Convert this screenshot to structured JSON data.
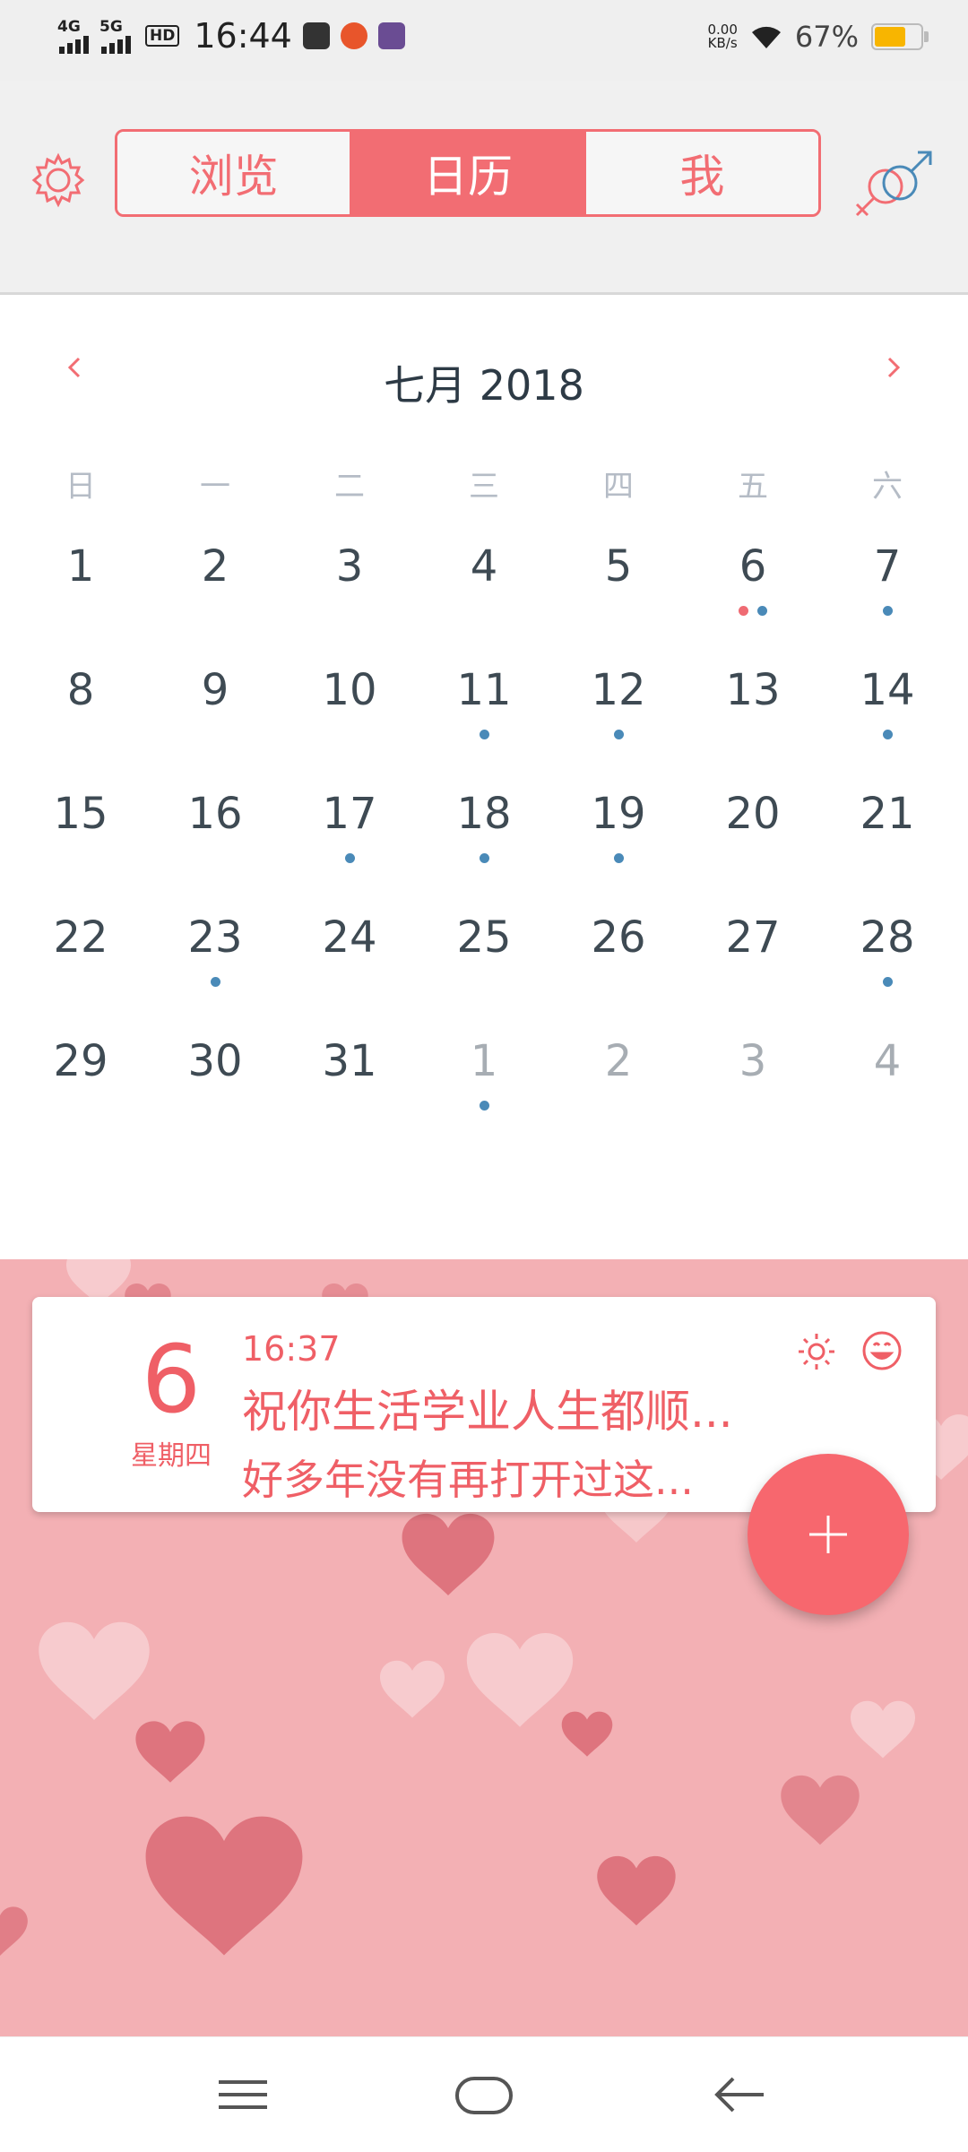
{
  "status_bar": {
    "network1": "4G",
    "network2": "5G",
    "hd_label": "HD",
    "time": "16:44",
    "speed_value": "0.00",
    "speed_unit": "KB/s",
    "battery_percent": "67%",
    "battery_level": 0.67,
    "battery_color": "#f8b500"
  },
  "header": {
    "tabs": [
      {
        "label": "浏览",
        "active": false
      },
      {
        "label": "日历",
        "active": true
      },
      {
        "label": "我",
        "active": false
      }
    ],
    "accent_color": "#f26d73",
    "settings_icon": "gear-icon",
    "gender_icon": "gender-symbols-icon"
  },
  "calendar": {
    "month_title": "七月 2018",
    "weekdays": [
      "日",
      "一",
      "二",
      "三",
      "四",
      "五",
      "六"
    ],
    "days": [
      {
        "day": "1",
        "dots": []
      },
      {
        "day": "2",
        "dots": []
      },
      {
        "day": "3",
        "dots": []
      },
      {
        "day": "4",
        "dots": []
      },
      {
        "day": "5",
        "dots": []
      },
      {
        "day": "6",
        "dots": [
          "red",
          "blue"
        ]
      },
      {
        "day": "7",
        "dots": [
          "blue"
        ]
      },
      {
        "day": "8",
        "dots": []
      },
      {
        "day": "9",
        "dots": []
      },
      {
        "day": "10",
        "dots": []
      },
      {
        "day": "11",
        "dots": [
          "blue"
        ]
      },
      {
        "day": "12",
        "dots": [
          "blue"
        ]
      },
      {
        "day": "13",
        "dots": []
      },
      {
        "day": "14",
        "dots": [
          "blue"
        ]
      },
      {
        "day": "15",
        "dots": []
      },
      {
        "day": "16",
        "dots": []
      },
      {
        "day": "17",
        "dots": [
          "blue"
        ]
      },
      {
        "day": "18",
        "dots": [
          "blue"
        ]
      },
      {
        "day": "19",
        "dots": [
          "blue"
        ]
      },
      {
        "day": "20",
        "dots": []
      },
      {
        "day": "21",
        "dots": []
      },
      {
        "day": "22",
        "dots": []
      },
      {
        "day": "23",
        "dots": [
          "blue"
        ]
      },
      {
        "day": "24",
        "dots": []
      },
      {
        "day": "25",
        "dots": []
      },
      {
        "day": "26",
        "dots": []
      },
      {
        "day": "27",
        "dots": []
      },
      {
        "day": "28",
        "dots": [
          "blue"
        ]
      },
      {
        "day": "29",
        "dots": []
      },
      {
        "day": "30",
        "dots": []
      },
      {
        "day": "31",
        "dots": []
      },
      {
        "day": "1",
        "dots": [
          "blue"
        ],
        "other_month": true
      },
      {
        "day": "2",
        "dots": [],
        "other_month": true
      },
      {
        "day": "3",
        "dots": [],
        "other_month": true
      },
      {
        "day": "4",
        "dots": [],
        "other_month": true
      }
    ],
    "dot_colors": {
      "red": "#ef6b73",
      "blue": "#4a8ab8"
    }
  },
  "entry_card": {
    "day": "6",
    "weekday": "星期四",
    "time": "16:37",
    "title": "祝你生活学业人生都顺...",
    "preview": "好多年没有再打开过这...",
    "weather_icon": "sun-icon",
    "mood_icon": "smiley-icon"
  },
  "fab": {
    "icon": "plus-icon",
    "color": "#f7676e"
  },
  "nav_bar": {
    "icons": [
      "menu-icon",
      "home-icon",
      "back-icon"
    ]
  }
}
